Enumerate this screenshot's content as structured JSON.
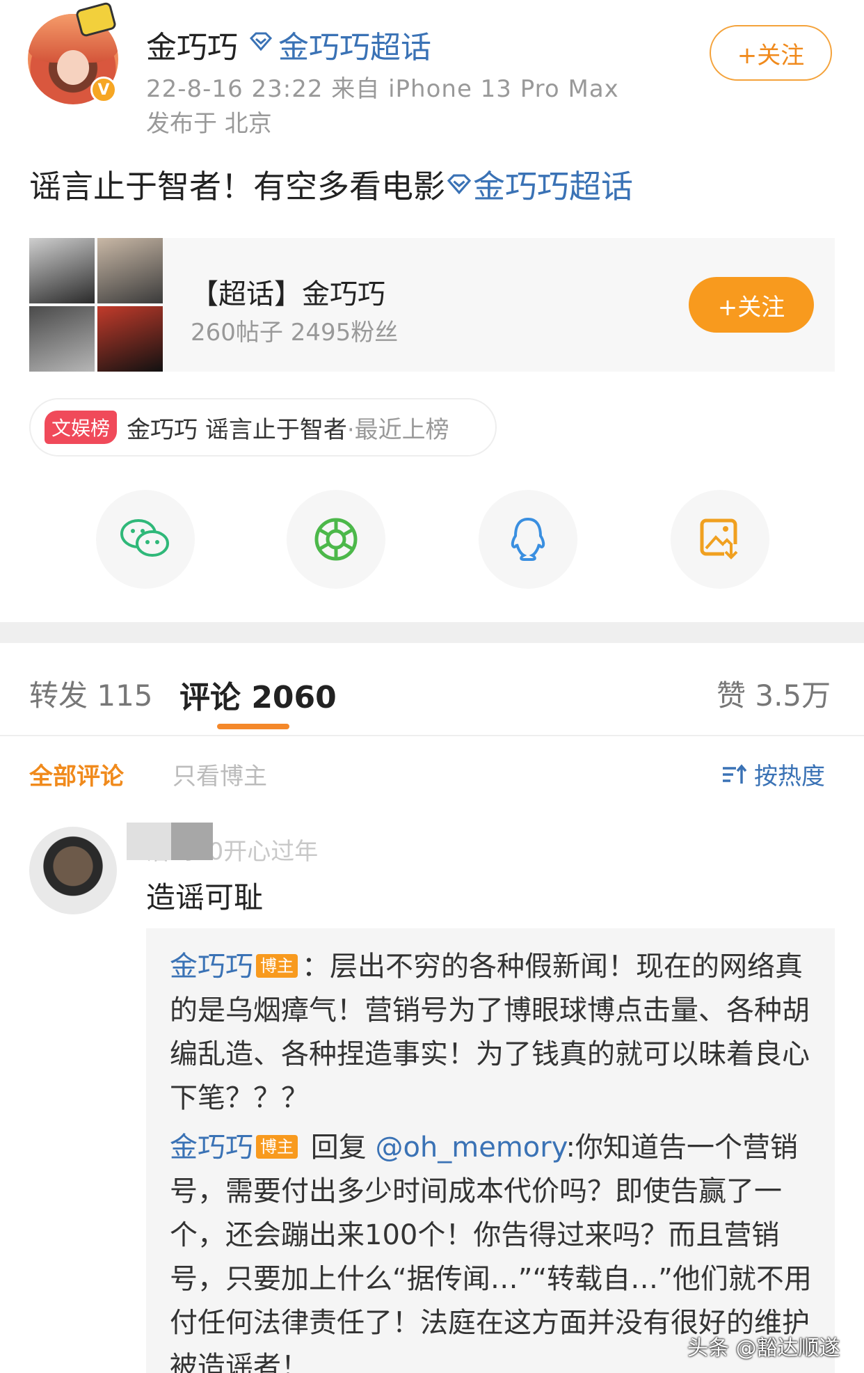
{
  "header": {
    "user_name": "金巧巧",
    "topic_link": "金巧巧超话",
    "meta": "22-8-16 23:22  来自 iPhone 13 Pro Max",
    "location": "发布于 北京",
    "follow_label": "+关注",
    "verified_mark": "V"
  },
  "post": {
    "text": "谣言止于智者！有空多看电影",
    "topic_link": "金巧巧超话"
  },
  "topic_card": {
    "title": "【超话】金巧巧",
    "stats": "260帖子 2495粉丝",
    "follow_label": "+关注"
  },
  "ranking": {
    "badge": "文娱榜",
    "text": "金巧巧 谣言止于智者",
    "suffix": "·最近上榜"
  },
  "share": {
    "icons": [
      "wechat-icon",
      "moments-icon",
      "qq-icon",
      "save-image-icon"
    ]
  },
  "tabs": {
    "repost": "转发 115",
    "comment": "评论 2060",
    "like": "赞 3.5万"
  },
  "filters": {
    "all": "全部评论",
    "host_only": "只看博主",
    "sort": "按热度"
  },
  "comment": {
    "name": "治到50开心过年",
    "text": "造谣可耻"
  },
  "replies": [
    {
      "name": "金巧巧",
      "badge": "博主",
      "text": "：层出不穷的各种假新闻！现在的网络真的是乌烟瘴气！营销号为了博眼球博点击量、各种胡编乱造、各种捏造事实！为了钱真的就可以昧着良心下笔？？？"
    },
    {
      "name": "金巧巧",
      "badge": "博主",
      "reply_word": " 回复 ",
      "mention": "@oh_memory",
      "text": ":你知道告一个营销号，需要付出多少时间成本代价吗？即使告赢了一个，还会蹦出来100个！你告得过来吗？而且营销号，只要加上什么“据传闻…”“转载自…”他们就不用付任何法律责任了！法庭在这方面并没有很好的维护被造谣者！"
    }
  ],
  "watermark": "头条 @豁达顺遂",
  "colors": {
    "link": "#3a72b5",
    "accent_orange": "#f89a1e",
    "rank_red": "#f04a5a"
  }
}
